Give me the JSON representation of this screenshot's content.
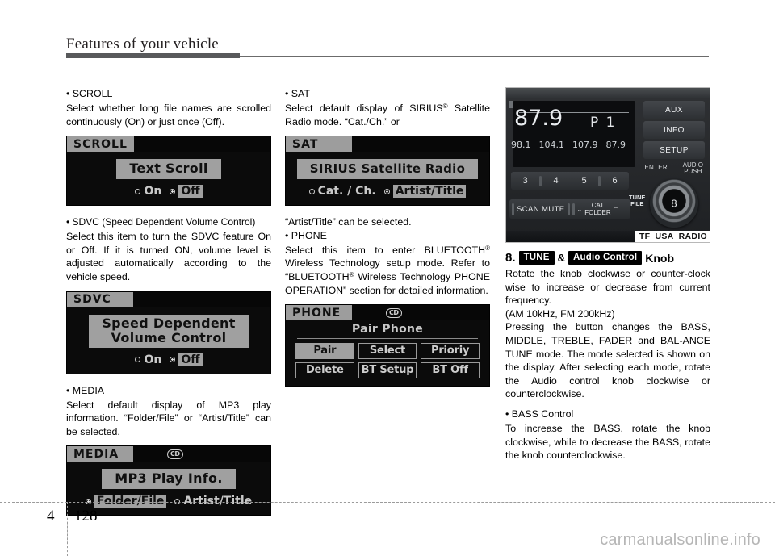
{
  "header": {
    "title": "Features of your vehicle"
  },
  "col1": {
    "scroll": {
      "bullet": "• SCROLL",
      "body": "Select whether long file names are scrolled continuously (On) or just once (Off).",
      "panel": {
        "tab": "SCROLL",
        "button": "Text Scroll",
        "options": [
          {
            "label": "On",
            "selected": false
          },
          {
            "label": "Off",
            "selected": true
          }
        ]
      }
    },
    "sdvc": {
      "bullet": "• SDVC (Speed Dependent Volume Control)",
      "body": "Select this item to turn the SDVC feature On or Off. If it is turned ON, volume level is adjusted automatically according to the vehicle speed.",
      "panel": {
        "tab": "SDVC",
        "button_line1": "Speed Dependent",
        "button_line2": "Volume Control",
        "options": [
          {
            "label": "On",
            "selected": false
          },
          {
            "label": "Off",
            "selected": true
          }
        ]
      }
    },
    "media": {
      "bullet": "• MEDIA",
      "body": "Select default display of MP3 play information. “Folder/File” or “Artist/Title” can be selected.",
      "panel": {
        "tab": "MEDIA",
        "badge": "CD",
        "button": "MP3 Play Info.",
        "options": [
          {
            "label": "Folder/File",
            "selected": true
          },
          {
            "label": "Artist/Title",
            "selected": false
          }
        ]
      }
    }
  },
  "col2": {
    "sat": {
      "bullet": "• SAT",
      "body_a": "Select default display of SIRIUS",
      "body_b": "Satellite Radio mode. “Cat./Ch.” or",
      "panel": {
        "tab": "SAT",
        "button": "SIRIUS Satellite Radio",
        "options": [
          {
            "label": "Cat. / Ch.",
            "selected": false
          },
          {
            "label": "Artist/Title",
            "selected": true
          }
        ]
      }
    },
    "sat_cont": "“Artist/Title” can be selected.",
    "phone": {
      "bullet": "• PHONE",
      "body_a": "Select this item to enter BLUETOOTH",
      "body_b": "Wireless Technology setup mode. Refer to “BLUETOOTH",
      "body_c": "Wireless Technology PHONE OPERATION” section for detailed information.",
      "panel": {
        "tab": "PHONE",
        "badge": "CD",
        "title": "Pair Phone",
        "buttons": [
          {
            "label": "Pair",
            "selected": true
          },
          {
            "label": "Select",
            "selected": false
          },
          {
            "label": "Prioriy",
            "selected": false
          },
          {
            "label": "Delete",
            "selected": false
          },
          {
            "label": "BT Setup",
            "selected": false
          },
          {
            "label": "BT Off",
            "selected": false
          }
        ]
      }
    }
  },
  "col3": {
    "radio": {
      "frequency": "87.9",
      "preset_indicator": "P 1",
      "presets": [
        "98.1",
        "104.1",
        "107.9",
        "87.9"
      ],
      "number_buttons": [
        "3",
        "4",
        "5",
        "6"
      ],
      "scan_label": "SCAN",
      "mute_label": "MUTE",
      "cat_label": "CAT",
      "folder_label": "FOLDER",
      "down_arrow": "⌄",
      "up_arrow": "⌃",
      "tune_label": "TUNE",
      "file_label": "FILE",
      "right_buttons": [
        "AUX",
        "INFO",
        "SETUP"
      ],
      "enter_label": "ENTER",
      "audio_label": "AUDIO",
      "push_label": "PUSH",
      "knob_number": "8",
      "caption": "TF_USA_RADIO"
    },
    "item8": {
      "number": "8.",
      "chip1": "TUNE",
      "amp": "&",
      "chip2": "Audio Control",
      "suffix": "Knob"
    },
    "body1": "Rotate the knob clockwise or counter-clock wise to increase or decrease from current frequency.",
    "body2": "(AM 10kHz, FM 200kHz)",
    "body3": "Pressing the button changes the BASS, MIDDLE, TREBLE, FADER and BAL-ANCE TUNE mode. The mode selected is shown on the display. After selecting each mode, rotate the Audio control knob clockwise or counterclockwise.",
    "bass": {
      "bullet": "• BASS Control",
      "body": "To increase the BASS, rotate the knob clockwise, while to decrease the BASS, rotate the knob counterclockwise."
    }
  },
  "footer": {
    "chapter": "4",
    "page": "128",
    "watermark": "carmanualsonline.info"
  }
}
